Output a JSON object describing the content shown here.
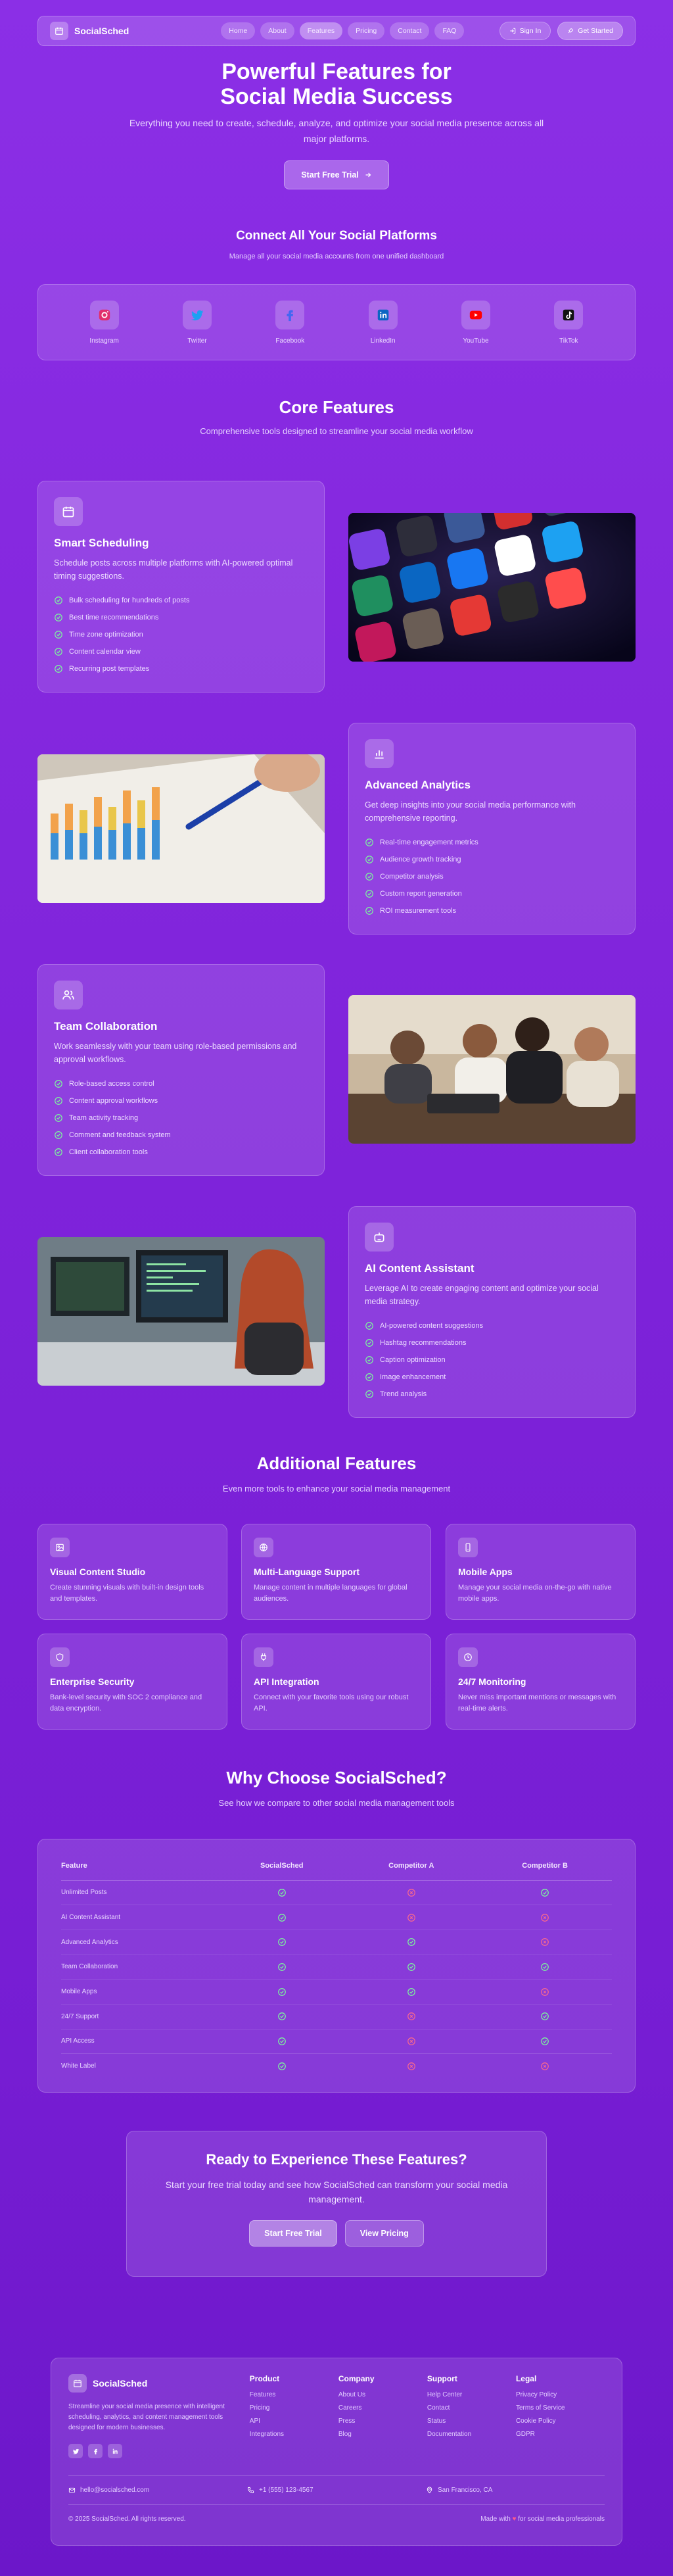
{
  "nav": {
    "brand": "SocialSched",
    "links": [
      "Home",
      "About",
      "Features",
      "Pricing",
      "Contact",
      "FAQ"
    ],
    "active": "Features",
    "sign_in": "Sign In",
    "get_started": "Get Started"
  },
  "hero": {
    "title_line1": "Powerful Features for",
    "title_line2": "Social Media Success",
    "subtitle": "Everything you need to create, schedule, analyze, and optimize your social media presence across all major platforms.",
    "cta": "Start Free Trial"
  },
  "platforms": {
    "title": "Connect All Your Social Platforms",
    "subtitle": "Manage all your social media accounts from one unified dashboard",
    "items": [
      {
        "label": "Instagram",
        "icon": "instagram-icon"
      },
      {
        "label": "Twitter",
        "icon": "twitter-icon"
      },
      {
        "label": "Facebook",
        "icon": "facebook-icon"
      },
      {
        "label": "LinkedIn",
        "icon": "linkedin-icon"
      },
      {
        "label": "YouTube",
        "icon": "youtube-icon"
      },
      {
        "label": "TikTok",
        "icon": "tiktok-icon"
      }
    ]
  },
  "core": {
    "title": "Core Features",
    "subtitle": "Comprehensive tools designed to streamline your social media workflow",
    "features": [
      {
        "icon": "calendar-icon",
        "title": "Smart Scheduling",
        "description": "Schedule posts across multiple platforms with AI-powered optimal timing suggestions.",
        "bullets": [
          "Bulk scheduling for hundreds of posts",
          "Best time recommendations",
          "Time zone optimization",
          "Content calendar view",
          "Recurring post templates"
        ]
      },
      {
        "icon": "bar-chart-icon",
        "title": "Advanced Analytics",
        "description": "Get deep insights into your social media performance with comprehensive reporting.",
        "bullets": [
          "Real-time engagement metrics",
          "Audience growth tracking",
          "Competitor analysis",
          "Custom report generation",
          "ROI measurement tools"
        ]
      },
      {
        "icon": "users-icon",
        "title": "Team Collaboration",
        "description": "Work seamlessly with your team using role-based permissions and approval workflows.",
        "bullets": [
          "Role-based access control",
          "Content approval workflows",
          "Team activity tracking",
          "Comment and feedback system",
          "Client collaboration tools"
        ]
      },
      {
        "icon": "robot-icon",
        "title": "AI Content Assistant",
        "description": "Leverage AI to create engaging content and optimize your social media strategy.",
        "bullets": [
          "AI-powered content suggestions",
          "Hashtag recommendations",
          "Caption optimization",
          "Image enhancement",
          "Trend analysis"
        ]
      }
    ]
  },
  "additional": {
    "title": "Additional Features",
    "subtitle": "Even more tools to enhance your social media management",
    "items": [
      {
        "icon": "image-icon",
        "title": "Visual Content Studio",
        "description": "Create stunning visuals with built-in design tools and templates."
      },
      {
        "icon": "globe-icon",
        "title": "Multi-Language Support",
        "description": "Manage content in multiple languages for global audiences."
      },
      {
        "icon": "mobile-icon",
        "title": "Mobile Apps",
        "description": "Manage your social media on-the-go with native mobile apps."
      },
      {
        "icon": "shield-icon",
        "title": "Enterprise Security",
        "description": "Bank-level security with SOC 2 compliance and data encryption."
      },
      {
        "icon": "plug-icon",
        "title": "API Integration",
        "description": "Connect with your favorite tools using our robust API."
      },
      {
        "icon": "clock-icon",
        "title": "24/7 Monitoring",
        "description": "Never miss important mentions or messages with real-time alerts."
      }
    ]
  },
  "compare": {
    "title": "Why Choose SocialSched?",
    "subtitle": "See how we compare to other social media management tools",
    "headers": [
      "Feature",
      "SocialSched",
      "Competitor A",
      "Competitor B"
    ],
    "rows": [
      {
        "feature": "Unlimited Posts",
        "values": [
          true,
          false,
          true
        ]
      },
      {
        "feature": "AI Content Assistant",
        "values": [
          true,
          false,
          false
        ]
      },
      {
        "feature": "Advanced Analytics",
        "values": [
          true,
          true,
          false
        ]
      },
      {
        "feature": "Team Collaboration",
        "values": [
          true,
          true,
          true
        ]
      },
      {
        "feature": "Mobile Apps",
        "values": [
          true,
          true,
          false
        ]
      },
      {
        "feature": "24/7 Support",
        "values": [
          true,
          false,
          true
        ]
      },
      {
        "feature": "API Access",
        "values": [
          true,
          false,
          true
        ]
      },
      {
        "feature": "White Label",
        "values": [
          true,
          false,
          false
        ]
      }
    ]
  },
  "cta": {
    "title": "Ready to Experience These Features?",
    "subtitle": "Start your free trial today and see how SocialSched can transform your social media management.",
    "primary": "Start Free Trial",
    "secondary": "View Pricing"
  },
  "footer": {
    "brand": "SocialSched",
    "description": "Streamline your social media presence with intelligent scheduling, analytics, and content management tools designed for modern businesses.",
    "columns": [
      {
        "title": "Product",
        "links": [
          "Features",
          "Pricing",
          "API",
          "Integrations"
        ]
      },
      {
        "title": "Company",
        "links": [
          "About Us",
          "Careers",
          "Press",
          "Blog"
        ]
      },
      {
        "title": "Support",
        "links": [
          "Help Center",
          "Contact",
          "Status",
          "Documentation"
        ]
      },
      {
        "title": "Legal",
        "links": [
          "Privacy Policy",
          "Terms of Service",
          "Cookie Policy",
          "GDPR"
        ]
      }
    ],
    "email": "hello@socialsched.com",
    "phone": "+1 (555) 123-4567",
    "location": "San Francisco, CA",
    "copyright": "© 2025 SocialSched. All rights reserved.",
    "made_with_prefix": "Made with",
    "made_with_suffix": "for social media professionals"
  }
}
